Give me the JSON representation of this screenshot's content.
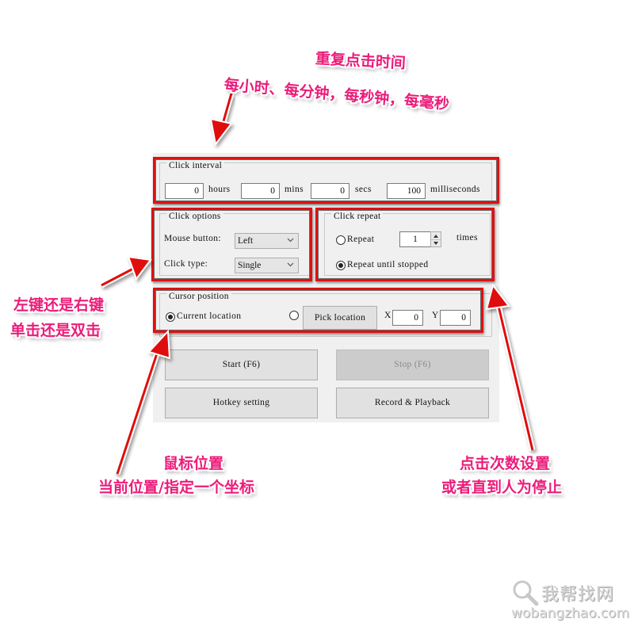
{
  "click_interval": {
    "title": "Click interval",
    "hours": {
      "value": "0",
      "unit": "hours"
    },
    "mins": {
      "value": "0",
      "unit": "mins"
    },
    "secs": {
      "value": "0",
      "unit": "secs"
    },
    "milliseconds": {
      "value": "100",
      "unit": "milliseconds"
    }
  },
  "click_options": {
    "title": "Click options",
    "mouse_button_label": "Mouse button:",
    "mouse_button_value": "Left",
    "click_type_label": "Click type:",
    "click_type_value": "Single"
  },
  "click_repeat": {
    "title": "Click repeat",
    "repeat_label": "Repeat",
    "repeat_count": "1",
    "times_label": "times",
    "until_stopped_label": "Repeat until stopped",
    "selected": "until_stopped"
  },
  "cursor_position": {
    "title": "Cursor position",
    "current_location_label": "Current location",
    "pick_location_label": "Pick location",
    "x_label": "X",
    "x_value": "0",
    "y_label": "Y",
    "y_value": "0",
    "selected": "current_location"
  },
  "buttons": {
    "start": "Start (F6)",
    "stop": "Stop (F6)",
    "hotkey": "Hotkey setting",
    "record": "Record & Playback"
  },
  "annotations": {
    "interval_title": "重复点击时间",
    "interval_detail": "每小时、每分钟，每秒钟，每毫秒",
    "options_line1": "左键还是右键",
    "options_line2": "单击还是双击",
    "position_line1": "鼠标位置",
    "position_line2": "当前位置/指定一个坐标",
    "repeat_line1": "点击次数设置",
    "repeat_line2": "或者直到人为停止",
    "color": "#ec1c7a"
  },
  "highlight_color": "#e01010",
  "watermark": {
    "cn": "我帮找网",
    "url": "wobangzhao.com"
  }
}
